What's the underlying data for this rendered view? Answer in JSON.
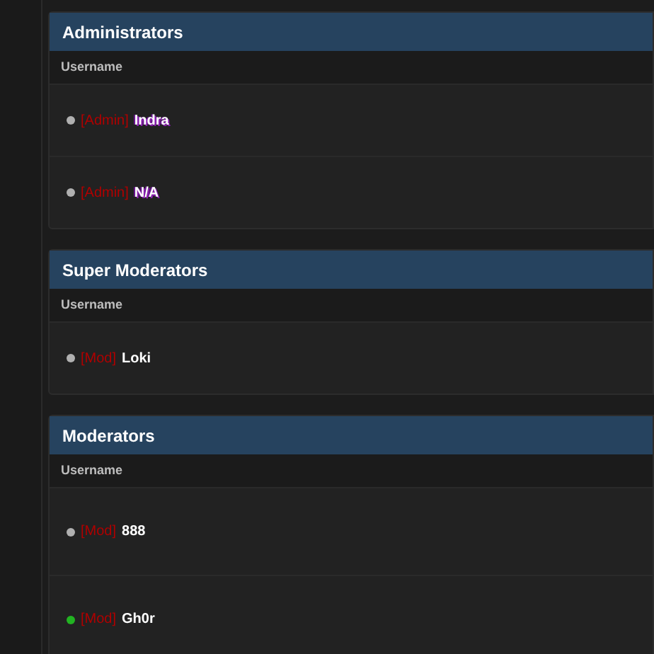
{
  "groups": [
    {
      "title": "Administrators",
      "column": "Username",
      "members": [
        {
          "rank": "[Admin]",
          "name": "Indra",
          "online": false,
          "highlight": true
        },
        {
          "rank": "[Admin]",
          "name": "N/A",
          "online": false,
          "highlight": true
        }
      ]
    },
    {
      "title": "Super Moderators",
      "column": "Username",
      "members": [
        {
          "rank": "[Mod]",
          "name": "Loki",
          "online": false,
          "highlight": false
        }
      ]
    },
    {
      "title": "Moderators",
      "column": "Username",
      "members": [
        {
          "rank": "[Mod]",
          "name": "888",
          "online": false,
          "highlight": false
        },
        {
          "rank": "[Mod]",
          "name": "Gh0r",
          "online": true,
          "highlight": false
        }
      ]
    }
  ]
}
